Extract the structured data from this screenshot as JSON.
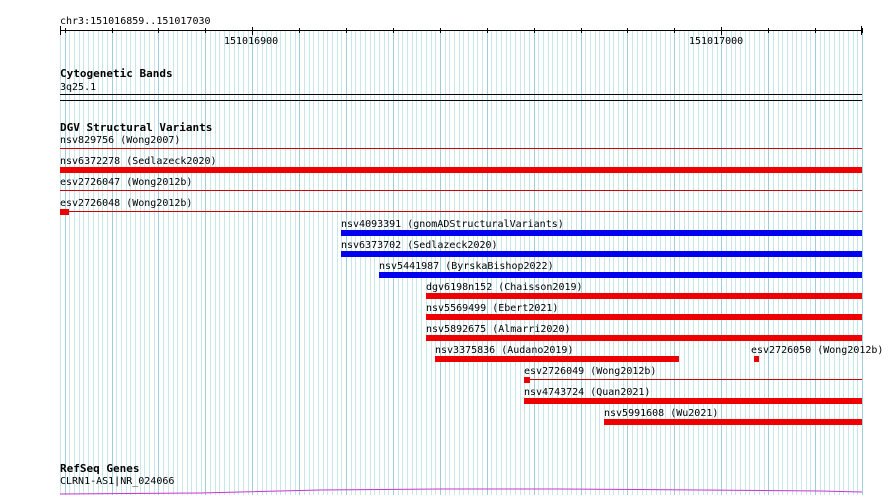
{
  "ruler": {
    "region": "chr3:151016859..151017030",
    "ticks": [
      {
        "pos": 151016900,
        "label": "151016900"
      },
      {
        "pos": 151017000,
        "label": "151017000"
      }
    ]
  },
  "tracks": {
    "cytoband": {
      "title": "Cytogenetic Bands",
      "band_name": "3q25.1"
    },
    "dgv": {
      "title": "DGV Structural Variants",
      "colors": {
        "gain": "#0000ee",
        "loss": "#ee0000",
        "line": "#cc0000"
      },
      "features": [
        {
          "label": "nsv829756 (Wong2007)",
          "start": 151016859,
          "end": 151017030,
          "type": "line"
        },
        {
          "label": "nsv6372278 (Sedlazeck2020)",
          "start": 151016859,
          "end": 151017030,
          "type": "loss"
        },
        {
          "label": "esv2726047 (Wong2012b)",
          "start": 151016859,
          "end": 151017030,
          "type": "line"
        },
        {
          "label": "esv2726048 (Wong2012b)",
          "start": 151016859,
          "end": 151017030,
          "type": "line",
          "mark_end": 151016861
        },
        {
          "label": "nsv4093391 (gnomADStructuralVariants)",
          "start": 151016919,
          "end": 151017030,
          "type": "gain"
        },
        {
          "label": "nsv6373702 (Sedlazeck2020)",
          "start": 151016919,
          "end": 151017030,
          "type": "gain"
        },
        {
          "label": "nsv5441987 (ByrskaBishop2022)",
          "start": 151016927,
          "end": 151017030,
          "type": "gain"
        },
        {
          "label": "dgv6198n152 (Chaisson2019)",
          "start": 151016937,
          "end": 151017030,
          "type": "loss"
        },
        {
          "label": "nsv5569499 (Ebert2021)",
          "start": 151016937,
          "end": 151017030,
          "type": "loss"
        },
        {
          "label": "nsv5892675 (Almarri2020)",
          "start": 151016937,
          "end": 151017030,
          "type": "loss"
        },
        {
          "label": "nsv3375836 (Audano2019)",
          "start": 151016939,
          "end": 151016991,
          "type": "loss"
        },
        {
          "label": "esv2726050 (Wong2012b)",
          "start": 151017007,
          "end": 151017008,
          "type": "loss"
        },
        {
          "label": "esv2726049 (Wong2012b)",
          "start": 151016958,
          "end": 151017030,
          "type": "line",
          "mark_end": 151016959
        },
        {
          "label": "nsv4743724 (Quan2021)",
          "start": 151016958,
          "end": 151017030,
          "type": "loss"
        },
        {
          "label": "nsv5991608 (Wu2021)",
          "start": 151016975,
          "end": 151017030,
          "type": "loss"
        }
      ]
    },
    "refseq": {
      "title": "RefSeq Genes",
      "gene_label": "CLRN1-AS1|NR_024066",
      "color": "#cc33cc"
    }
  }
}
